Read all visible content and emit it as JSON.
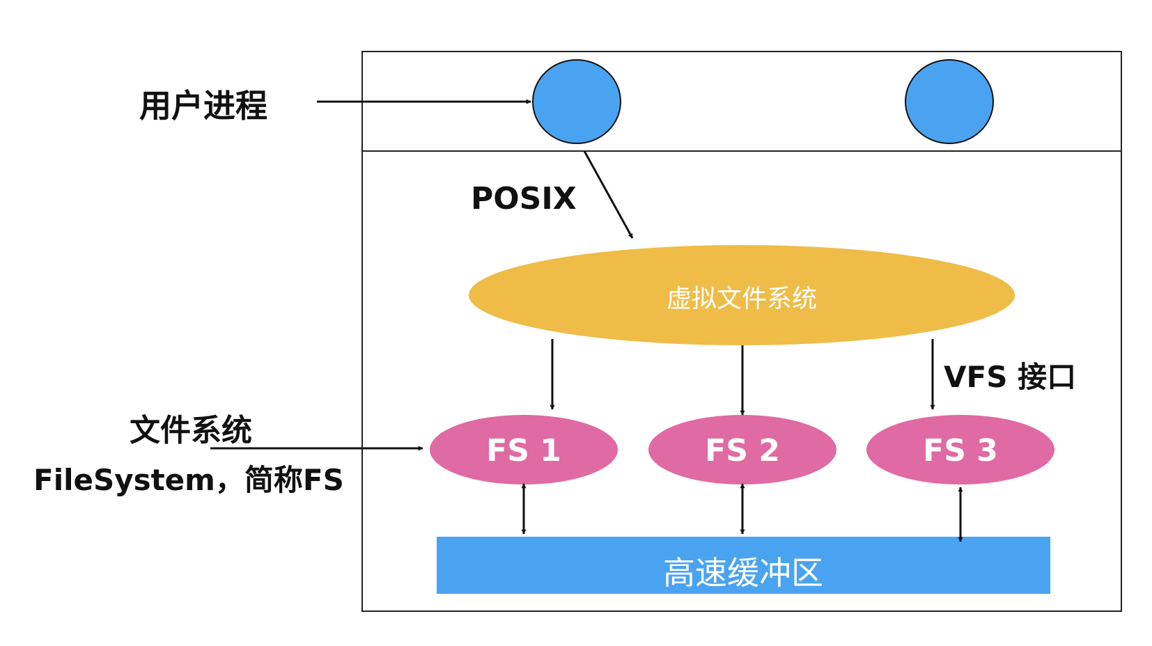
{
  "labels": {
    "user_process": "用户进程",
    "posix": "POSIX",
    "vfs_interface": "VFS 接口",
    "fs_label_line1": "文件系统",
    "fs_label_line2": "FileSystem，简称FS"
  },
  "shapes": {
    "vfs": "虚拟文件系统",
    "fs": [
      "FS 1",
      "FS 2",
      "FS 3"
    ],
    "buffer_cache": "高速缓冲区"
  },
  "colors": {
    "process_circle": "#4aa3f0",
    "vfs_ellipse": "#efbc48",
    "fs_ellipse": "#e06aa3",
    "buffer_bar": "#4aa3f0",
    "line": "#111111"
  }
}
